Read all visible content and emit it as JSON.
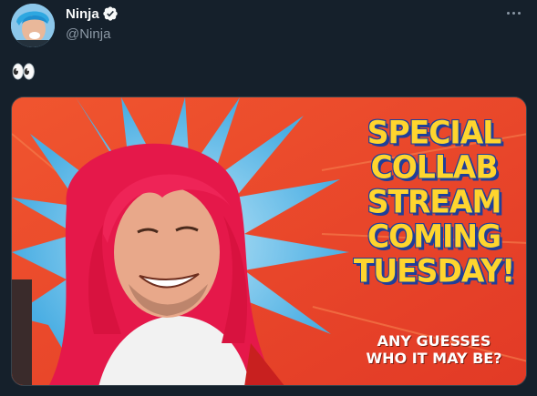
{
  "author": {
    "display_name": "Ninja",
    "handle": "@Ninja",
    "verified": true,
    "avatar_icon": "avatar-photo"
  },
  "more_menu": {
    "icon": "more-horizontal-icon"
  },
  "tweet": {
    "text": "👀"
  },
  "media": {
    "headline_lines": [
      "SPECIAL",
      "COLLAB",
      "STREAM",
      "COMING",
      "TUESDAY!"
    ],
    "subtitle_lines": [
      "ANY GUESSES",
      "WHO IT MAY BE?"
    ],
    "colors": {
      "background": "#e8472c",
      "headline": "#ffd52e",
      "headline_outline": "#1f3f9a",
      "burst": "#58b7e8",
      "wig": "#e5184a"
    }
  },
  "theme": {
    "page_bg": "#15202b",
    "text_primary": "#f7f9f9",
    "text_secondary": "#8b98a5",
    "verified_blue": "#1d9bf0"
  }
}
